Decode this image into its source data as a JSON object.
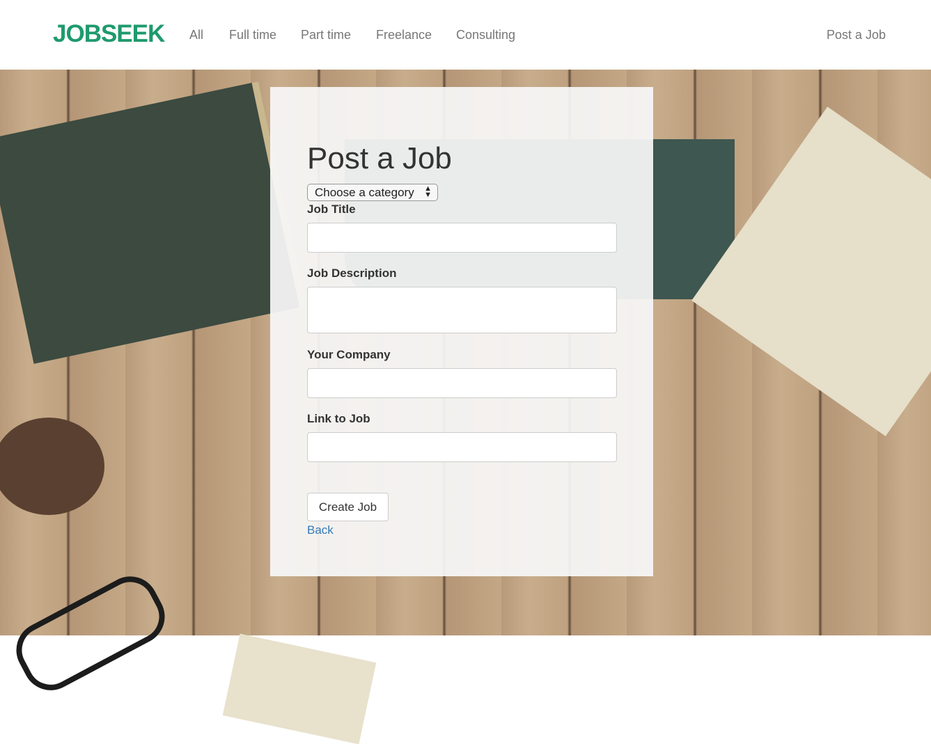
{
  "nav": {
    "brand": "JOBSEEK",
    "links": [
      "All",
      "Full time",
      "Part time",
      "Freelance",
      "Consulting"
    ],
    "post_job": "Post a Job"
  },
  "form": {
    "title": "Post a Job",
    "category_select": "Choose a category",
    "fields": [
      "Job Title",
      "Job Description",
      "Your Company",
      "Link to Job"
    ],
    "submit": "Create Job",
    "back": "Back"
  },
  "colors": {
    "brand": "#1f9a6d",
    "link": "#337ab7"
  }
}
